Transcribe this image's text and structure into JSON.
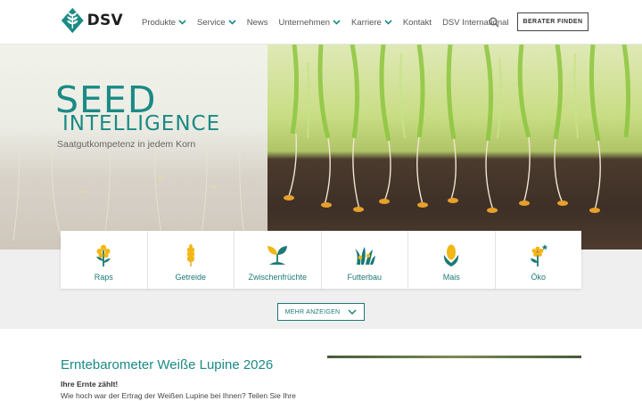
{
  "brand": {
    "name": "DSV",
    "color": "#1b8a85"
  },
  "nav": {
    "items": [
      {
        "label": "Produkte",
        "has_dropdown": true
      },
      {
        "label": "Service",
        "has_dropdown": true
      },
      {
        "label": "News",
        "has_dropdown": false
      },
      {
        "label": "Unternehmen",
        "has_dropdown": true
      },
      {
        "label": "Karriere",
        "has_dropdown": true
      },
      {
        "label": "Kontakt",
        "has_dropdown": false
      },
      {
        "label": "DSV International",
        "has_dropdown": false
      }
    ],
    "search_icon": "search-icon",
    "cta_label": "BERATER FINDEN"
  },
  "hero": {
    "title_line1": "SEED",
    "title_line2": "INTELLIGENCE",
    "subtitle": "Saatgutkompetenz in jedem Korn"
  },
  "categories": {
    "items": [
      {
        "label": "Raps",
        "icon": "rapeseed-icon"
      },
      {
        "label": "Getreide",
        "icon": "grain-icon"
      },
      {
        "label": "Zwischenfrüchte",
        "icon": "sprout-icon"
      },
      {
        "label": "Futterbau",
        "icon": "grass-icon"
      },
      {
        "label": "Mais",
        "icon": "corn-icon"
      },
      {
        "label": "Öko",
        "icon": "eco-flower-icon"
      }
    ],
    "more_label": "MEHR ANZEIGEN"
  },
  "article": {
    "title": "Erntebarometer Weiße Lupine 2026",
    "kicker": "Ihre Ernte zählt!",
    "text": "Wie hoch war der Ertrag der Weißen Lupine bei Ihnen? Teilen Sie Ihre"
  },
  "colors": {
    "accent": "#1b8a85",
    "icon_green": "#1b7a75",
    "icon_yellow": "#f2b714"
  }
}
